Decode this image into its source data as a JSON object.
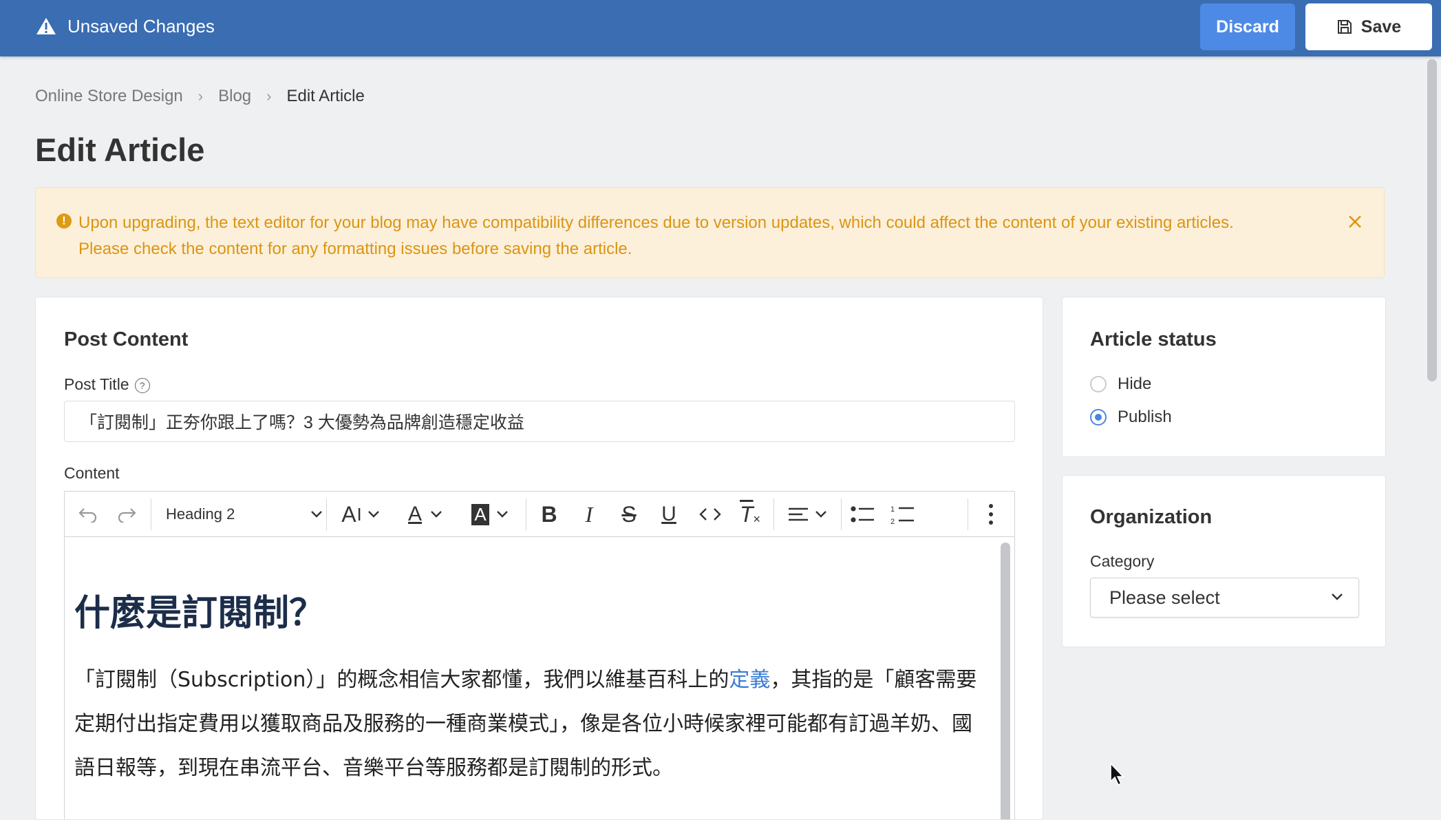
{
  "topbar": {
    "warning_text": "Unsaved Changes",
    "discard_label": "Discard",
    "save_label": "Save",
    "bg_color": "#3a6db1",
    "discard_color": "#4d8ae6"
  },
  "breadcrumb": {
    "items": [
      "Online Store Design",
      "Blog",
      "Edit Article"
    ]
  },
  "page": {
    "title": "Edit Article"
  },
  "alert": {
    "line1": "Upon upgrading, the text editor for your blog may have compatibility differences due to version updates, which could affect the content of your existing articles.",
    "line2": "Please check the content for any formatting issues before saving the article.",
    "color": "#dc9412",
    "bg": "#fcf0da"
  },
  "post_content": {
    "card_title": "Post Content",
    "post_title_label": "Post Title",
    "post_title_value": "「訂閱制」正夯你跟上了嗎？3 大優勢為品牌創造穩定收益",
    "content_label": "Content",
    "toolbar": {
      "heading_select": "Heading 2"
    },
    "editor": {
      "heading": "什麼是訂閱制？",
      "para_before_link": "「訂閱制（Subscription）」的概念相信大家都懂，我們以維基百科上的",
      "link_text": "定義",
      "para_after_link": "，其指的是「顧客需要定期付出指定費用以獲取商品及服務的一種商業模式」，像是各位小時候家裡可能都有訂過羊奶、國語日報等，到現在串流平台、音樂平台等服務都是訂閱制的形式。"
    }
  },
  "article_status": {
    "title": "Article status",
    "options": [
      {
        "label": "Hide",
        "checked": false
      },
      {
        "label": "Publish",
        "checked": true
      }
    ]
  },
  "organization": {
    "title": "Organization",
    "category_label": "Category",
    "category_value": "Please select"
  }
}
